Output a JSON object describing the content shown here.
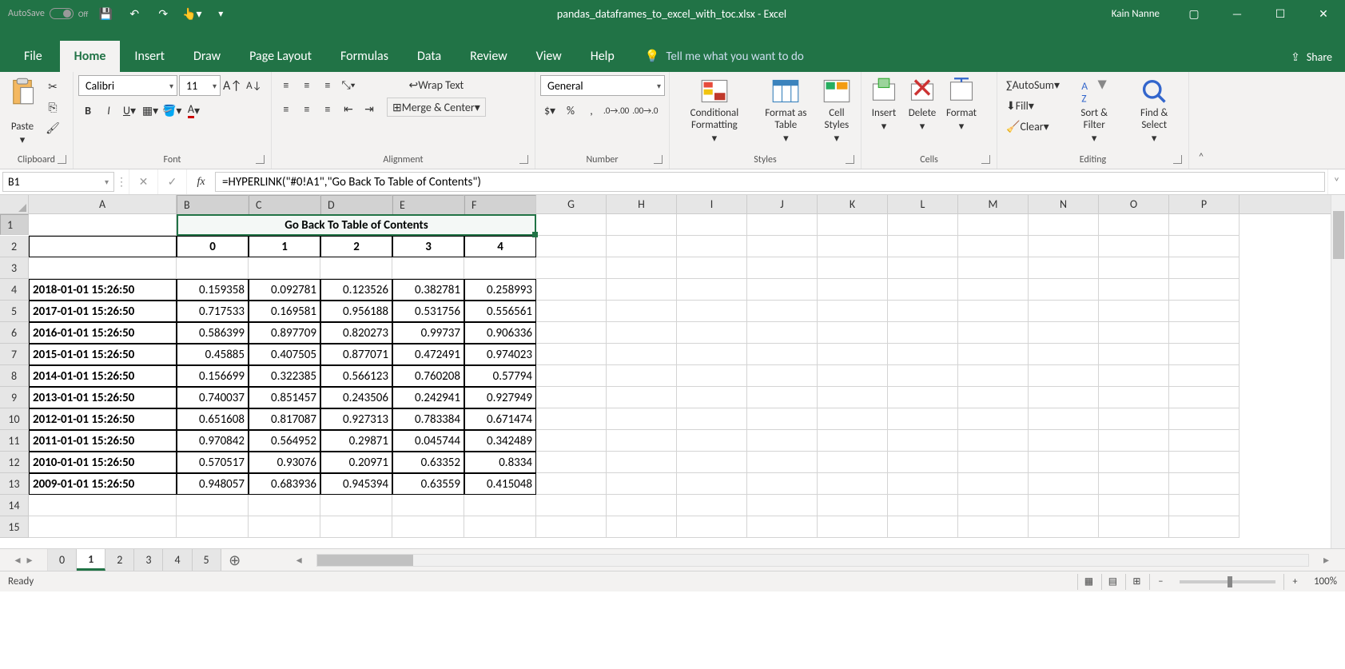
{
  "titlebar": {
    "autosave": "AutoSave",
    "autosave_state": "Off",
    "title": "pandas_dataframes_to_excel_with_toc.xlsx - Excel",
    "user": "Kain Nanne"
  },
  "tabs": {
    "file": "File",
    "home": "Home",
    "insert": "Insert",
    "draw": "Draw",
    "page_layout": "Page Layout",
    "formulas": "Formulas",
    "data": "Data",
    "review": "Review",
    "view": "View",
    "help": "Help",
    "tellme": "Tell me what you want to do",
    "share": "Share"
  },
  "ribbon": {
    "clipboard": {
      "paste": "Paste",
      "label": "Clipboard"
    },
    "font": {
      "name": "Calibri",
      "size": "11",
      "label": "Font"
    },
    "alignment": {
      "wrap": "Wrap Text",
      "merge": "Merge & Center",
      "label": "Alignment"
    },
    "number": {
      "format": "General",
      "label": "Number"
    },
    "styles": {
      "conditional": "Conditional Formatting",
      "format_table": "Format as Table",
      "cell_styles": "Cell Styles",
      "label": "Styles"
    },
    "cells": {
      "insert": "Insert",
      "delete": "Delete",
      "format": "Format",
      "label": "Cells"
    },
    "editing": {
      "autosum": "AutoSum",
      "fill": "Fill",
      "clear": "Clear",
      "sort": "Sort & Filter",
      "find": "Find & Select",
      "label": "Editing"
    }
  },
  "formula_bar": {
    "name_box": "B1",
    "formula": "=HYPERLINK(\"#0!A1\",\"Go Back To Table of Contents\")"
  },
  "grid": {
    "columns": [
      "A",
      "B",
      "C",
      "D",
      "E",
      "F",
      "G",
      "H",
      "I",
      "J",
      "K",
      "L",
      "M",
      "N",
      "O",
      "P"
    ],
    "merged_b1_f1": "Go Back To Table of Contents",
    "headers_row2": [
      "0",
      "1",
      "2",
      "3",
      "4"
    ],
    "rows": [
      {
        "r": 4,
        "label": "2018-01-01 15:26:50",
        "v": [
          "0.159358",
          "0.092781",
          "0.123526",
          "0.382781",
          "0.258993"
        ]
      },
      {
        "r": 5,
        "label": "2017-01-01 15:26:50",
        "v": [
          "0.717533",
          "0.169581",
          "0.956188",
          "0.531756",
          "0.556561"
        ]
      },
      {
        "r": 6,
        "label": "2016-01-01 15:26:50",
        "v": [
          "0.586399",
          "0.897709",
          "0.820273",
          "0.99737",
          "0.906336"
        ]
      },
      {
        "r": 7,
        "label": "2015-01-01 15:26:50",
        "v": [
          "0.45885",
          "0.407505",
          "0.877071",
          "0.472491",
          "0.974023"
        ]
      },
      {
        "r": 8,
        "label": "2014-01-01 15:26:50",
        "v": [
          "0.156699",
          "0.322385",
          "0.566123",
          "0.760208",
          "0.57794"
        ]
      },
      {
        "r": 9,
        "label": "2013-01-01 15:26:50",
        "v": [
          "0.740037",
          "0.851457",
          "0.243506",
          "0.242941",
          "0.927949"
        ]
      },
      {
        "r": 10,
        "label": "2012-01-01 15:26:50",
        "v": [
          "0.651608",
          "0.817087",
          "0.927313",
          "0.783384",
          "0.671474"
        ]
      },
      {
        "r": 11,
        "label": "2011-01-01 15:26:50",
        "v": [
          "0.970842",
          "0.564952",
          "0.29871",
          "0.045744",
          "0.342489"
        ]
      },
      {
        "r": 12,
        "label": "2010-01-01 15:26:50",
        "v": [
          "0.570517",
          "0.93076",
          "0.20971",
          "0.63352",
          "0.8334"
        ]
      },
      {
        "r": 13,
        "label": "2009-01-01 15:26:50",
        "v": [
          "0.948057",
          "0.683936",
          "0.945394",
          "0.63559",
          "0.415048"
        ]
      }
    ]
  },
  "sheets": {
    "tabs": [
      "0",
      "1",
      "2",
      "3",
      "4",
      "5"
    ],
    "active": "1"
  },
  "status": {
    "ready": "Ready",
    "zoom": "100%"
  }
}
